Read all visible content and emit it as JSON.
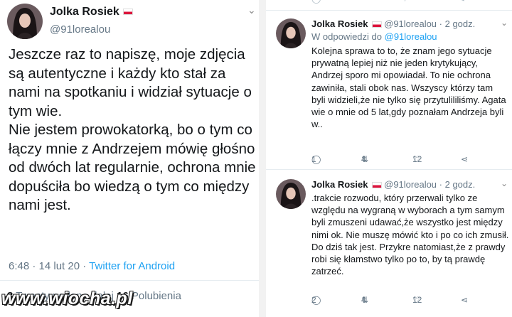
{
  "main_tweet": {
    "author_name": "Jolka Rosiek",
    "handle": "@91lorealou",
    "paragraphs": [
      "Jeszcze raz to napiszę, moje zdjęcia są autentyczne i każdy kto stał za nami na spotkaniu i widział sytuacje o tym wie.",
      "Nie jestem prowokatorką, bo o tym co łączy mnie z Andrzejem mówię głośno od dwóch lat regularnie, ochrona mnie dopuściła bo wiedzą o tym co między nami jest."
    ],
    "time": "6:48 · 14 lut 20",
    "source": "Twitter for Android",
    "retweets_count": "3",
    "retweets_label": "Tweety podane dalej",
    "likes_count": "16",
    "likes_label": "Polubienia"
  },
  "replies": [
    {
      "author_name": "Jolka Rosiek",
      "handle": "@91lorealou",
      "age": "· 2 godz.",
      "reply_prefix": "W odpowiedzi do",
      "reply_to": "@91lorealou",
      "text": "Kolejna sprawa to to, że znam jego sytuacje prywatną lepiej niż nie jeden krytykujący, Andrzej sporo mi opowiadał. To nie ochrona zawiniła, stali obok nas. Wszyscy którzy tam byli widzieli,że nie tylko się przytulililiśmy. Agata wie o mnie od 5 lat,gdy poznałam Andrzeja byli w..",
      "replies_count": "1",
      "retweets_count": "4",
      "likes_count": "12"
    },
    {
      "author_name": "Jolka Rosiek",
      "handle": "@91lorealou",
      "age": "· 2 godz.",
      "text": ".trakcie rozwodu, który przerwali tylko ze względu na wygraną w wyborach a tym samym byli zmuszeni udawać,że wszystko jest między nimi ok. Nie muszę mówić kto i po co ich zmusił. Do dziś tak jest. Przykre natomiast,że z prawdy robi się kłamstwo tylko po to, by tą prawdę zatrzeć.",
      "replies_count": "2",
      "retweets_count": "4",
      "likes_count": "12"
    }
  ],
  "watermark": "www.wiocha.pl",
  "icons": {
    "chevron": "chevron-down-icon",
    "reply": "reply-icon",
    "retweet": "retweet-icon",
    "like": "heart-icon",
    "share": "share-icon"
  },
  "colors": {
    "link": "#1da1f2",
    "secondary_text": "#657786",
    "flag_red": "#dc143c"
  }
}
